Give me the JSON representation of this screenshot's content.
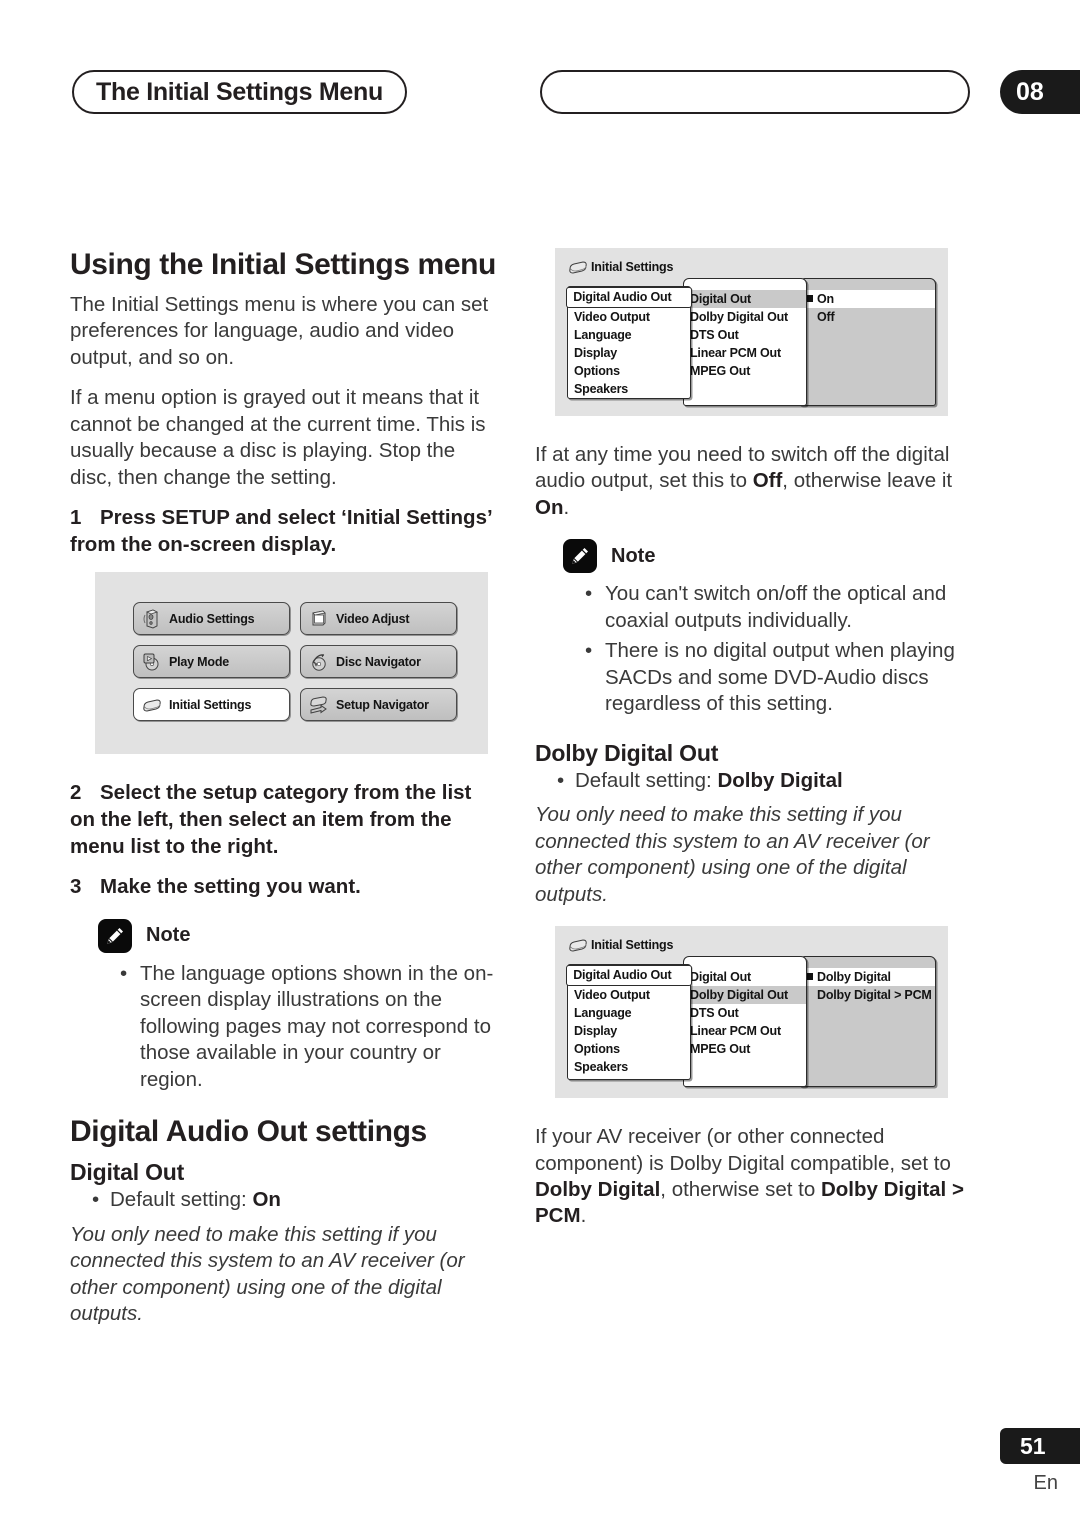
{
  "header": {
    "chapter_title": "The Initial Settings Menu",
    "chapter_number": "08"
  },
  "footer": {
    "page_number": "51",
    "language_code": "En"
  },
  "left_column": {
    "heading": "Using the Initial Settings menu",
    "para1": "The Initial Settings menu is where you can set preferences for language, audio and video output, and so on.",
    "para2": "If a menu option is grayed out it means that it cannot be changed at the current time. This is usually because a disc is playing. Stop the disc, then change the setting.",
    "step1_num": "1",
    "step1_text": "Press SETUP and select ‘Initial Settings’ from the on-screen display.",
    "step2_num": "2",
    "step2_text": "Select the setup category from the list on the left, then select an item from the menu list to the right.",
    "step3_num": "3",
    "step3_text": "Make the setting you want.",
    "note_label": "Note",
    "note_items": [
      "The language options shown in the on-screen display illustrations on the following pages may not correspond to those available in your country or region."
    ],
    "section_heading": "Digital Audio Out settings",
    "digital_out_heading": "Digital Out",
    "digital_out_default_prefix": "Default setting: ",
    "digital_out_default_value": "On",
    "digital_out_italic": "You only need to make this setting if you connected this system to an AV receiver (or other component) using one of the digital outputs."
  },
  "osd_home": {
    "buttons": [
      {
        "label": "Audio Settings",
        "icon": "speaker-icon",
        "selected": false
      },
      {
        "label": "Video Adjust",
        "icon": "monitor-icon",
        "selected": false
      },
      {
        "label": "Play Mode",
        "icon": "play-disc-icon",
        "selected": false
      },
      {
        "label": "Disc Navigator",
        "icon": "disc-navigator-icon",
        "selected": false
      },
      {
        "label": "Initial Settings",
        "icon": "initial-settings-icon",
        "selected": true
      },
      {
        "label": "Setup Navigator",
        "icon": "setup-navigator-icon",
        "selected": false
      }
    ]
  },
  "osd_menu_digital_out": {
    "title": "Initial Settings",
    "title_icon": "initial-settings-icon",
    "categories": [
      "Digital Audio Out",
      "Video Output",
      "Language",
      "Display",
      "Options",
      "Speakers"
    ],
    "selected_category": "Digital Audio Out",
    "items": [
      "Digital Out",
      "Dolby Digital Out",
      "DTS Out",
      "Linear PCM Out",
      "MPEG Out"
    ],
    "selected_item": "Digital Out",
    "values": [
      "On",
      "Off"
    ],
    "selected_value": "On"
  },
  "osd_menu_dolby_digital_out": {
    "title": "Initial Settings",
    "title_icon": "initial-settings-icon",
    "categories": [
      "Digital Audio Out",
      "Video Output",
      "Language",
      "Display",
      "Options",
      "Speakers"
    ],
    "selected_category": "Digital Audio Out",
    "items": [
      "Digital Out",
      "Dolby Digital Out",
      "DTS Out",
      "Linear PCM Out",
      "MPEG Out"
    ],
    "selected_item": "Dolby Digital Out",
    "values": [
      "Dolby Digital",
      "Dolby Digital > PCM"
    ],
    "selected_value": "Dolby Digital"
  },
  "right_column": {
    "para1_a": "If at any time you need to switch off the digital audio output, set this to ",
    "para1_off": "Off",
    "para1_b": ", otherwise leave it ",
    "para1_on": "On",
    "para1_c": ".",
    "note_label": "Note",
    "note_items": [
      "You can't switch on/off the optical and coaxial outputs individually.",
      "There is no digital output when playing SACDs and some DVD-Audio discs regardless of this setting."
    ],
    "dolby_heading": "Dolby Digital Out",
    "dolby_default_prefix": "Default setting: ",
    "dolby_default_value": "Dolby Digital",
    "dolby_italic": "You only need to make this setting if you connected this system to an AV receiver (or other component) using one of the digital outputs.",
    "para2_a": "If your AV receiver (or other connected component) is Dolby Digital compatible, set to ",
    "para2_b1": "Dolby Digital",
    "para2_c": ", otherwise set to ",
    "para2_b2": "Dolby Digital > PCM",
    "para2_d": "."
  }
}
